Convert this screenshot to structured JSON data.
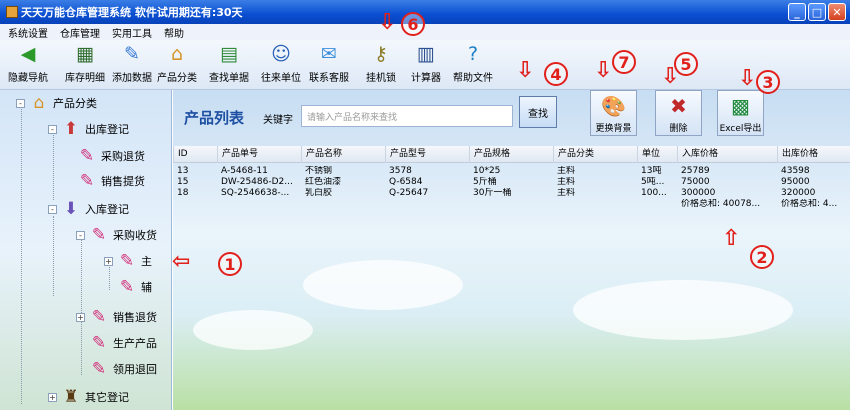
{
  "window": {
    "title": "天天万能仓库管理系统  软件试用期还有:30天",
    "minimize": "_",
    "maximize": "□",
    "close": "✕"
  },
  "menu": [
    "系统设置",
    "仓库管理",
    "实用工具",
    "帮助"
  ],
  "toolbar": [
    {
      "label": "隐藏导航",
      "icon": "back-arrow-icon"
    },
    {
      "label": "库存明细",
      "icon": "notebook-icon"
    },
    {
      "label": "添加数据",
      "icon": "edit-icon"
    },
    {
      "label": "产品分类",
      "icon": "house-icon"
    },
    {
      "label": "查找单据",
      "icon": "ledger-icon"
    },
    {
      "label": "往来单位",
      "icon": "users-icon"
    },
    {
      "label": "联系客服",
      "icon": "chat-icon"
    },
    {
      "label": "挂机锁",
      "icon": "keys-icon"
    },
    {
      "label": "计算器",
      "icon": "calculator-icon"
    },
    {
      "label": "帮助文件",
      "icon": "help-icon"
    }
  ],
  "tree": [
    {
      "label": "产品分类"
    },
    {
      "label": "出库登记"
    },
    {
      "label": "采购退货"
    },
    {
      "label": "销售提货"
    },
    {
      "label": "入库登记"
    },
    {
      "label": "采购收货"
    },
    {
      "label": "主"
    },
    {
      "label": "辅"
    },
    {
      "label": "销售退货"
    },
    {
      "label": "生产产品"
    },
    {
      "label": "领用退回"
    },
    {
      "label": "其它登记"
    }
  ],
  "panel": {
    "title": "产品列表",
    "keyword_label": "关键字",
    "search_placeholder": "请输入产品名称来查找",
    "search_btn": "查找",
    "change_bg": "更换背景",
    "delete": "删除",
    "export": "Excel导出"
  },
  "table": {
    "headers": [
      "ID",
      "产品单号",
      "产品名称",
      "产品型号",
      "产品规格",
      "产品分类",
      "单位",
      "入库价格",
      "出库价格"
    ],
    "rows": [
      [
        "13",
        "A-5468-11",
        "不锈钢",
        "3578",
        "10*25",
        "主料",
        "13吨",
        "25789",
        "43598"
      ],
      [
        "15",
        "DW-25486-D2...",
        "红色油漆",
        "Q-6584",
        "5斤桶",
        "主料",
        "5吨...",
        "75000",
        "95000"
      ],
      [
        "18",
        "SQ-2546638-...",
        "乳白胶",
        "Q-25647",
        "30斤一桶",
        "主料",
        "100...",
        "300000",
        "320000"
      ]
    ],
    "sum_in": "价格总和: 40078...",
    "sum_out": "价格总和: 4..."
  },
  "callouts": [
    "1",
    "2",
    "3",
    "4",
    "5",
    "6",
    "7"
  ],
  "colors": {
    "title_blue": "#0a4fd2",
    "callout_red": "#e2201b",
    "panel_title": "#1d4fa3"
  }
}
